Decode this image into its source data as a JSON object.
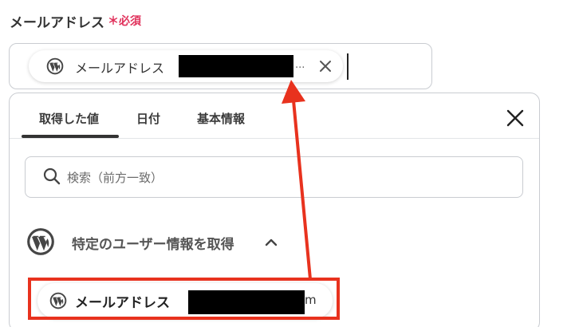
{
  "field": {
    "label": "メールアドレス",
    "required_mark": "＊必須"
  },
  "chip": {
    "label": "メールアドレス",
    "ellipsis": "...",
    "icon": "wordpress-icon",
    "close_icon": "close-icon"
  },
  "tabs": [
    {
      "label": "取得した値",
      "active": true
    },
    {
      "label": "日付",
      "active": false
    },
    {
      "label": "基本情報",
      "active": false
    }
  ],
  "search": {
    "placeholder": "検索（前方一致）",
    "icon": "search-icon"
  },
  "group": {
    "title": "特定のユーザー情報を取得",
    "icon": "wordpress-icon",
    "expanded": true
  },
  "value_item": {
    "label": "メールアドレス",
    "tail": "m",
    "icon": "wordpress-icon"
  },
  "colors": {
    "required": "#e0315b",
    "annotation": "#e8321e",
    "wordpress": "#464646"
  }
}
